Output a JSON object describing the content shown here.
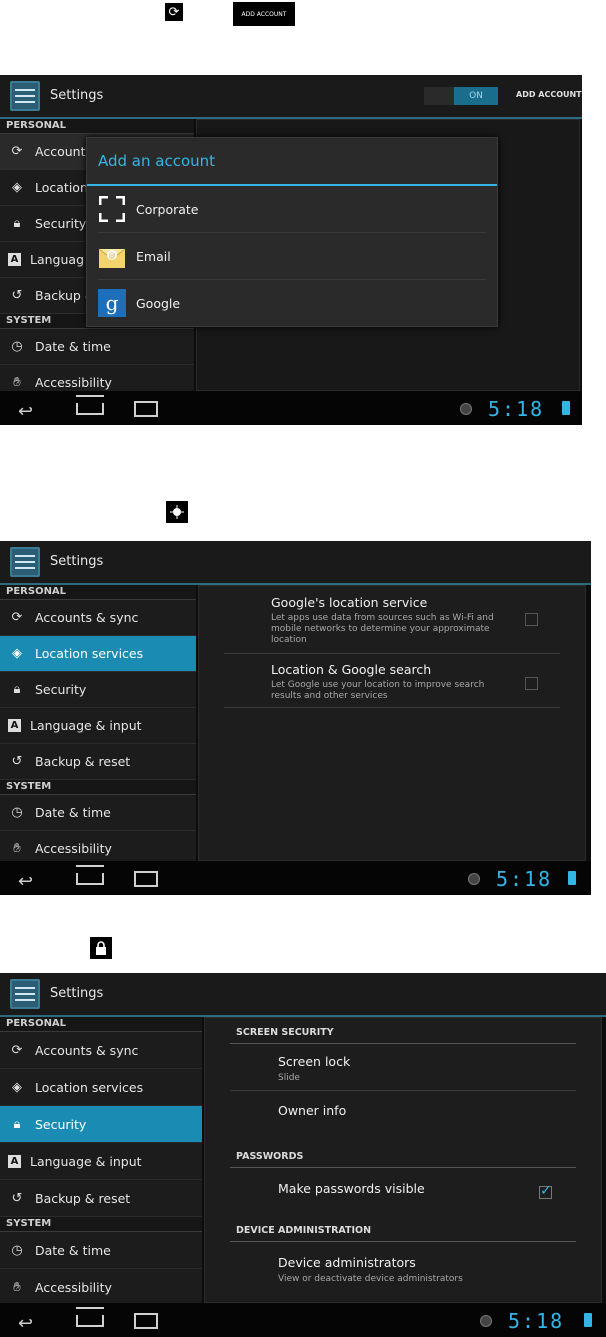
{
  "legend": {
    "add_account_label": "ADD ACCOUNT"
  },
  "settings": {
    "app_title": "Settings",
    "section_personal": "PERSONAL",
    "section_system": "SYSTEM",
    "items": {
      "accounts": "Accounts & sync",
      "accounts_cut": "Accounts",
      "location": "Location services",
      "location_cut": "Location",
      "security": "Security",
      "language": "Language & input",
      "language_cut": "Languag",
      "backup": "Backup & reset",
      "backup_cut": "Backup &",
      "datetime": "Date & time",
      "accessibility": "Accessibility"
    },
    "clock": "5:18"
  },
  "screen1": {
    "toggle_on": "ON",
    "add_account_button": "ADD ACCOUNT",
    "dialog_title": "Add an account",
    "options": {
      "corporate": "Corporate",
      "email": "Email",
      "google": "Google"
    }
  },
  "screen2": {
    "prefs": {
      "google_location": {
        "title": "Google's location service",
        "summary": "Let apps use data from sources such as Wi-Fi and mobile networks to determine your approximate location",
        "checked": false
      },
      "location_search": {
        "title": "Location & Google search",
        "summary": "Let Google use your location to improve search results and other services",
        "checked": false
      }
    }
  },
  "screen3": {
    "categories": {
      "screen_security": "SCREEN SECURITY",
      "passwords": "PASSWORDS",
      "device_admin": "DEVICE ADMINISTRATION"
    },
    "prefs": {
      "screen_lock": {
        "title": "Screen lock",
        "summary": "Slide"
      },
      "owner_info": {
        "title": "Owner info"
      },
      "passwords_visible": {
        "title": "Make passwords visible",
        "checked": true
      },
      "device_admins": {
        "title": "Device administrators",
        "summary": "View or deactivate device administrators"
      }
    }
  },
  "colors": {
    "accent": "#33b5e5",
    "selected": "#1a8bb3",
    "background": "#0c0c0c"
  }
}
